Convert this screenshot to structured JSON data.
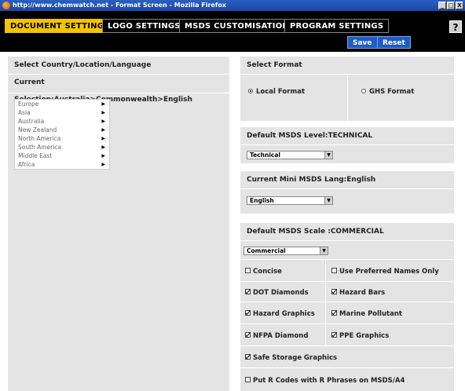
{
  "window": {
    "title": "http://www.chemwatch.net - Format Screen - Mozilla Firefox",
    "buttons": [
      "_",
      "□",
      "X"
    ]
  },
  "tabs": [
    {
      "label": "DOCUMENT SETTINGS",
      "active": true
    },
    {
      "label": "LOGO SETTINGS",
      "active": false
    },
    {
      "label": "MSDS CUSTOMISATION",
      "active": false
    },
    {
      "label": "PROGRAM SETTINGS",
      "active": false
    }
  ],
  "help": {
    "label": "?"
  },
  "actions": {
    "save_label": "Save",
    "reset_label": "Reset"
  },
  "left": {
    "heading": "Select Country/Location/Language",
    "current": "Current Selection:Australia>Commonwealth>English",
    "countries": [
      "Europe",
      "Asia",
      "Australia",
      "New Zealand",
      "North America",
      "South America",
      "Middle East",
      "Africa"
    ]
  },
  "format": {
    "heading": "Select Format",
    "local_label": "Local Format",
    "ghs_label": "GHS Format",
    "selected": "local"
  },
  "level": {
    "heading": "Default MSDS Level:TECHNICAL",
    "value": "Technical"
  },
  "mini": {
    "heading": "Current Mini MSDS Lang:English",
    "value": "English"
  },
  "scale": {
    "heading": "Default MSDS Scale :COMMERCIAL",
    "value": "Commercial"
  },
  "options": {
    "concise": {
      "label": "Concise",
      "checked": false
    },
    "preferred": {
      "label": "Use Preferred Names Only",
      "checked": false
    },
    "dot": {
      "label": "DOT Diamonds",
      "checked": true
    },
    "hazard_bars": {
      "label": "Hazard Bars",
      "checked": true
    },
    "hazard_graphics": {
      "label": "Hazard Graphics",
      "checked": true
    },
    "marine": {
      "label": "Marine Pollutant",
      "checked": true
    },
    "nfpa": {
      "label": "NFPA Diamond",
      "checked": true
    },
    "ppe": {
      "label": "PPE Graphics",
      "checked": true
    },
    "safe_storage": {
      "label": "Safe Storage Graphics",
      "checked": true
    },
    "r_codes": {
      "label": "Put R Codes with R Phrases on MSDS/A4",
      "checked": false
    }
  },
  "colors": {
    "active_tab": "#f5c400",
    "nav_bg": "#000000",
    "action_btn": "#1f5cc4",
    "panel_bg": "#e4e4e4"
  },
  "icons": {
    "dropdown": "▼",
    "submenu": "▶",
    "browser": "firefox-icon"
  }
}
